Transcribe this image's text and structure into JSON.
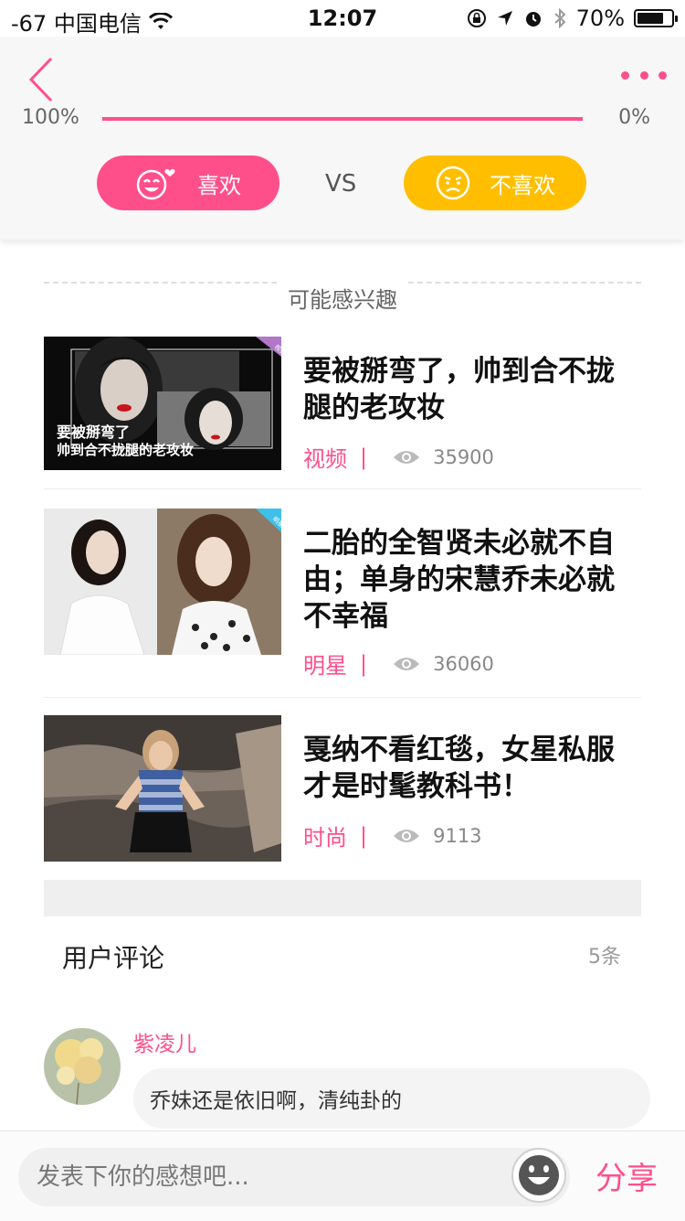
{
  "status_bar": {
    "carrier": "-67 中国电信",
    "time": "12:07",
    "battery": "70%"
  },
  "header": {
    "like_percent": "100%",
    "dislike_percent": "0%",
    "like_ratio": 1.0,
    "like_label": "喜欢",
    "vs_label": "VS",
    "dislike_label": "不喜欢"
  },
  "section": {
    "title": "可能感兴趣"
  },
  "articles": [
    {
      "title": "要被掰弯了，帅到合不拢腿的老攻妆",
      "category": "视频",
      "separator": "|",
      "views": "35900",
      "thumb_caption_1": "要被掰弯了",
      "thumb_caption_2": "帅到合不拢腿的老攻妆",
      "thumb_badge": "视频"
    },
    {
      "title": "二胎的全智贤未必就不自由；单身的宋慧乔未必就不幸福",
      "category": "明星",
      "separator": "|",
      "views": "36060",
      "thumb_badge": "明星"
    },
    {
      "title": "戛纳不看红毯，女星私服才是时髦教科书！",
      "category": "时尚",
      "separator": "|",
      "views": "9113"
    }
  ],
  "comments": {
    "title": "用户评论",
    "count": "5条",
    "items": [
      {
        "user": "紫凌儿",
        "text": "乔妹还是依旧啊，清纯卦的"
      }
    ]
  },
  "bottom_bar": {
    "placeholder": "发表下你的感想吧...",
    "share_label": "分享"
  },
  "colors": {
    "accent": "#ff4f8b",
    "dislike": "#ffbf00"
  },
  "icons": [
    "back-icon",
    "more-icon",
    "smile-heart-icon",
    "frown-icon",
    "eye-icon",
    "emoji-icon",
    "wifi-icon",
    "lock-rotation-icon",
    "location-icon",
    "alarm-icon",
    "bluetooth-icon",
    "battery-icon"
  ]
}
